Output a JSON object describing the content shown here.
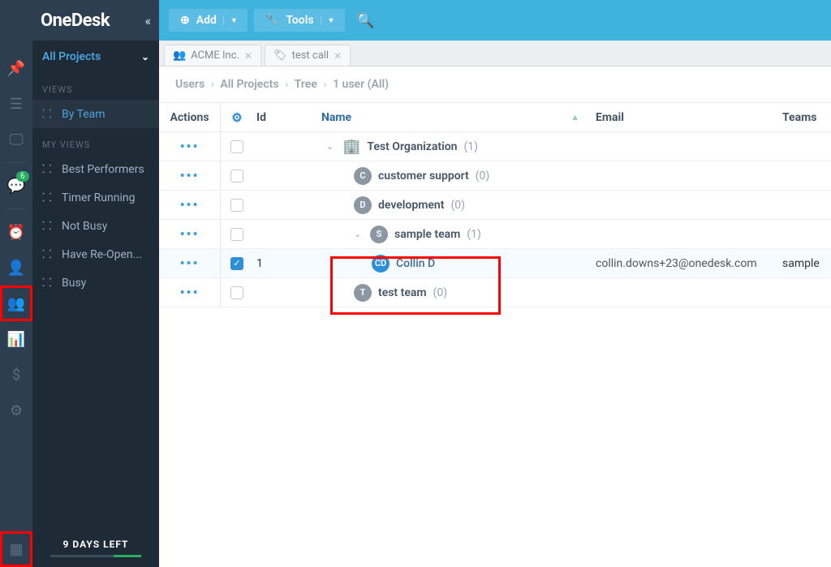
{
  "brand": "OneDesk",
  "collapse_icon": "«",
  "project_selector": {
    "label": "All Projects"
  },
  "sidebar": {
    "views_label": "VIEWS",
    "myviews_label": "MY VIEWS",
    "views": [
      {
        "icon": "sitemap",
        "label": "By Team",
        "selected": true
      }
    ],
    "myviews": [
      {
        "label": "Best Performers"
      },
      {
        "label": "Timer Running"
      },
      {
        "label": "Not Busy"
      },
      {
        "label": "Have Re-Open..."
      },
      {
        "label": "Busy"
      }
    ],
    "days_left": "9 DAYS LEFT"
  },
  "rail": {
    "badge_count": "6"
  },
  "topbar": {
    "add_label": "Add",
    "tools_label": "Tools"
  },
  "tabs": [
    {
      "icon": "team",
      "label": "ACME Inc."
    },
    {
      "icon": "ticket",
      "label": "test call"
    }
  ],
  "breadcrumbs": [
    "Users",
    "All Projects",
    "Tree",
    "1 user (All)"
  ],
  "columns": {
    "actions": "Actions",
    "id": "Id",
    "name": "Name",
    "email": "Email",
    "teams": "Teams"
  },
  "rows": [
    {
      "type": "org",
      "name": "Test Organization",
      "count": "(1)",
      "indent": 0,
      "expanded": true,
      "checked": false
    },
    {
      "type": "team",
      "initial": "C",
      "color": "#8b98a4",
      "name": "customer support",
      "count": "(0)",
      "indent": 1,
      "checked": false
    },
    {
      "type": "team",
      "initial": "D",
      "color": "#8b98a4",
      "name": "development",
      "count": "(0)",
      "indent": 1,
      "checked": false
    },
    {
      "type": "team",
      "initial": "S",
      "color": "#8b98a4",
      "name": "sample team",
      "count": "(1)",
      "indent": 1,
      "expanded": true,
      "checked": false
    },
    {
      "type": "user",
      "initial": "CD",
      "color": "#2d8fd6",
      "id": "1",
      "name": "Collin D",
      "email": "collin.downs+23@onedesk.com",
      "teams": "sample",
      "indent": 2,
      "checked": true
    },
    {
      "type": "team",
      "initial": "T",
      "color": "#8b98a4",
      "name": "test team",
      "count": "(0)",
      "indent": 1,
      "checked": false
    }
  ]
}
